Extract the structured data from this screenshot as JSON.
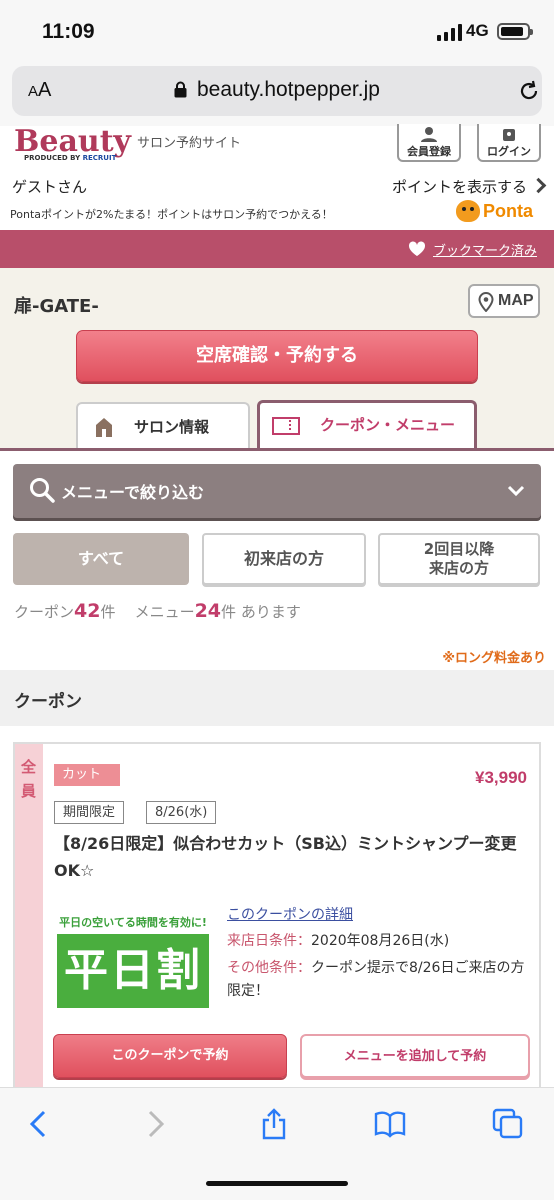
{
  "status_bar": {
    "time": "11:09",
    "network": "4G"
  },
  "browser": {
    "aa_label": "AA",
    "url": "beauty.hotpepper.jp"
  },
  "header": {
    "logo": "Beauty",
    "produced_by": "PRODUCED BY",
    "recruit": "RECRUIT",
    "salon_site": "サロン予約サイト",
    "register_label": "会員登録",
    "login_label": "ログイン",
    "guest": "ゲストさん",
    "show_points": "ポイントを表示する",
    "ponta_note": "Pontaポイントが2%たまる！ポイントはサロン予約でつかえる！",
    "ponta_logo": "Ponta"
  },
  "bookmark": {
    "label": "ブックマーク済み"
  },
  "salon": {
    "name": "扉-GATE-",
    "map_label": "MAP",
    "reserve_label": "空席確認・予約する",
    "tabs": [
      {
        "label": "サロン情報"
      },
      {
        "label": "クーポン・メニュー"
      }
    ]
  },
  "filter": {
    "label": "メニューで絞り込む",
    "segments": [
      {
        "label": "すべて"
      },
      {
        "label": "初来店の方"
      },
      {
        "label": "2回目以降",
        "label2": "来店の方"
      }
    ],
    "counts": {
      "coupon_prefix": "クーポン",
      "coupon_count": "42",
      "coupon_unit": "件",
      "menu_prefix": "メニュー",
      "menu_count": "24",
      "menu_unit": "件",
      "suffix": "あります"
    },
    "long_note": "※ロング料金あり"
  },
  "coupon_section": {
    "title": "クーポン"
  },
  "coupon": {
    "side_label_1": "全",
    "side_label_2": "員",
    "category": "カット",
    "price": "¥3,990",
    "tags": [
      "期間限定",
      "8/26(水)"
    ],
    "title": "【8/26日限定】似合わせカット（SB込）ミントシャンプー変更OK☆",
    "banner_top": "平日の空いてる時間を有効に!",
    "banner_big": "平日割",
    "detail_link": "このクーポンの詳細",
    "cond1_key": "来店日条件：",
    "cond1_val": "2020年08月26日(水)",
    "cond2_key": "その他条件：",
    "cond2_val": "クーポン提示で8/26日ご来店の方限定！",
    "btn_reserve": "このクーポンで予約",
    "btn_add_menu": "メニューを追加して予約"
  },
  "toolbar": {
    "icons": [
      "back-icon",
      "forward-icon",
      "share-icon",
      "bookmarks-icon",
      "tabs-icon"
    ]
  }
}
